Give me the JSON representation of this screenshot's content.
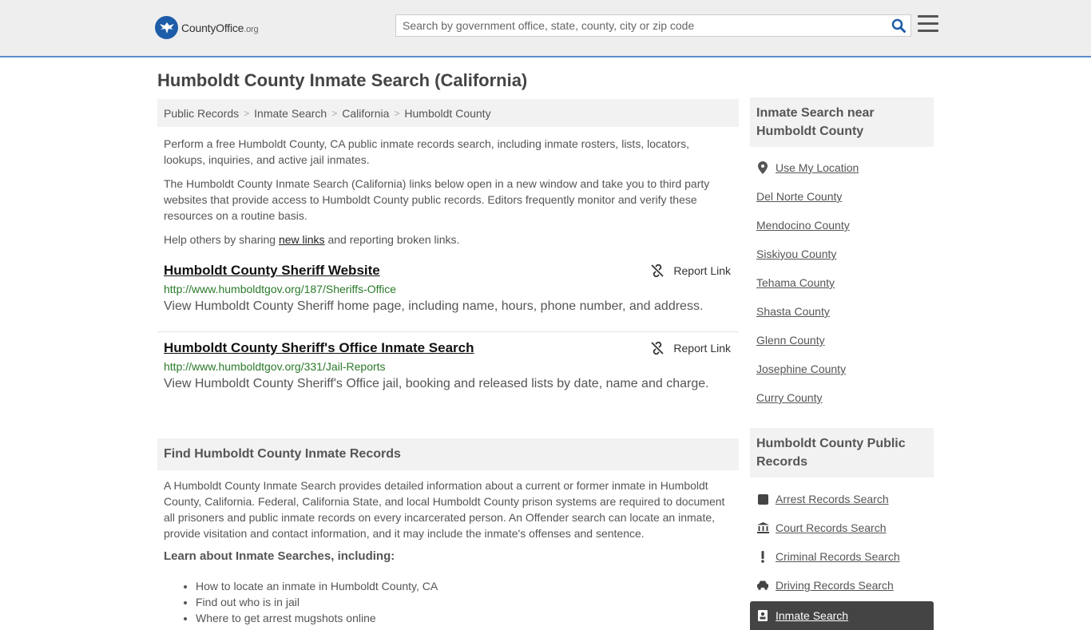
{
  "header": {
    "logo_main": "CountyOffice",
    "logo_org": ".org",
    "search_placeholder": "Search by government office, state, county, city or zip code"
  },
  "page": {
    "title": "Humboldt County Inmate Search (California)"
  },
  "breadcrumb": [
    "Public Records",
    "Inmate Search",
    "California",
    "Humboldt County"
  ],
  "intro": {
    "p1": "Perform a free Humboldt County, CA public inmate records search, including inmate rosters, lists, locators, lookups, inquiries, and active jail inmates.",
    "p2": "The Humboldt County Inmate Search (California) links below open in a new window and take you to third party websites that provide access to Humboldt County public records. Editors frequently monitor and verify these resources on a routine basis.",
    "p3_before": "Help others by sharing ",
    "p3_link": "new links",
    "p3_after": " and reporting broken links."
  },
  "results": [
    {
      "title": "Humboldt County Sheriff Website",
      "url": "http://www.humboldtgov.org/187/Sheriffs-Office",
      "desc": "View Humboldt County Sheriff home page, including name, hours, phone number, and address.",
      "report": "Report Link"
    },
    {
      "title": "Humboldt County Sheriff's Office Inmate Search",
      "url": "http://www.humboldtgov.org/331/Jail-Reports",
      "desc": "View Humboldt County Sheriff's Office jail, booking and released lists by date, name and charge.",
      "report": "Report Link"
    }
  ],
  "find": {
    "heading": "Find Humboldt County Inmate Records",
    "body": "A Humboldt County Inmate Search provides detailed information about a current or former inmate in Humboldt County, California. Federal, California State, and local Humboldt County prison systems are required to document all prisoners and public inmate records on every incarcerated person. An Offender search can locate an inmate, provide visitation and contact information, and it may include the inmate's offenses and sentence.",
    "learn": "Learn about Inmate Searches, including:",
    "bullets": [
      "How to locate an inmate in Humboldt County, CA",
      "Find out who is in jail",
      "Where to get arrest mugshots online"
    ]
  },
  "sidebar_near": {
    "heading": "Inmate Search near Humboldt County",
    "use_location": "Use My Location",
    "counties": [
      "Del Norte County",
      "Mendocino County",
      "Siskiyou County",
      "Tehama County",
      "Shasta County",
      "Glenn County",
      "Josephine County",
      "Curry County"
    ]
  },
  "sidebar_records": {
    "heading": "Humboldt County Public Records",
    "items": [
      {
        "label": "Arrest Records Search",
        "icon": "square-icon"
      },
      {
        "label": "Court Records Search",
        "icon": "courthouse-icon"
      },
      {
        "label": "Criminal Records Search",
        "icon": "exclamation-icon"
      },
      {
        "label": "Driving Records Search",
        "icon": "car-icon"
      },
      {
        "label": "Inmate Search",
        "icon": "inmate-icon"
      }
    ]
  },
  "colors": {
    "accent": "#5b8dc9",
    "link_green": "#2a7a2a",
    "panel": "#f2f2f2",
    "active": "#444444"
  }
}
